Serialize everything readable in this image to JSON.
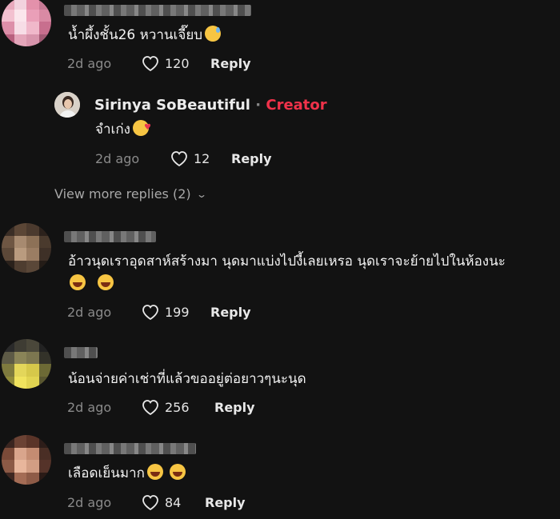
{
  "comments": [
    {
      "text": "น้ำผึ้งชั้น26 หวานเจี๊ยบ",
      "emoji": "grinning-sweat",
      "date": "2d ago",
      "likes": "120",
      "reply_label": "Reply"
    },
    {
      "text": "อ้าวนุดเราอุดสาห์สร้างมา นุดมาแบ่งไปงี้เลยเหรอ นุดเราจะย้ายไปในห้องนะ",
      "emoji": "laughing",
      "date": "2d ago",
      "likes": "199",
      "reply_label": "Reply"
    },
    {
      "text": "น้อนจ่ายค่าเช่าที่แล้วขออยู่ต่อยาวๆนะนุด",
      "date": "2d ago",
      "likes": "256",
      "reply_label": "Reply"
    },
    {
      "text": "เลือดเย็นมาก",
      "emoji": "laughing",
      "date": "2d ago",
      "likes": "84",
      "reply_label": "Reply"
    }
  ],
  "creator_reply": {
    "name": "Sirinya SoBeautiful",
    "separator": "·",
    "badge": "Creator",
    "text": "จำเก่ง",
    "emoji": "smiling-hearts",
    "date": "2d ago",
    "likes": "12",
    "reply_label": "Reply"
  },
  "view_more": "View more replies (2)",
  "colors": {
    "background": "#121212",
    "creator_badge": "#f0324a",
    "muted": "#8a8a8a"
  }
}
